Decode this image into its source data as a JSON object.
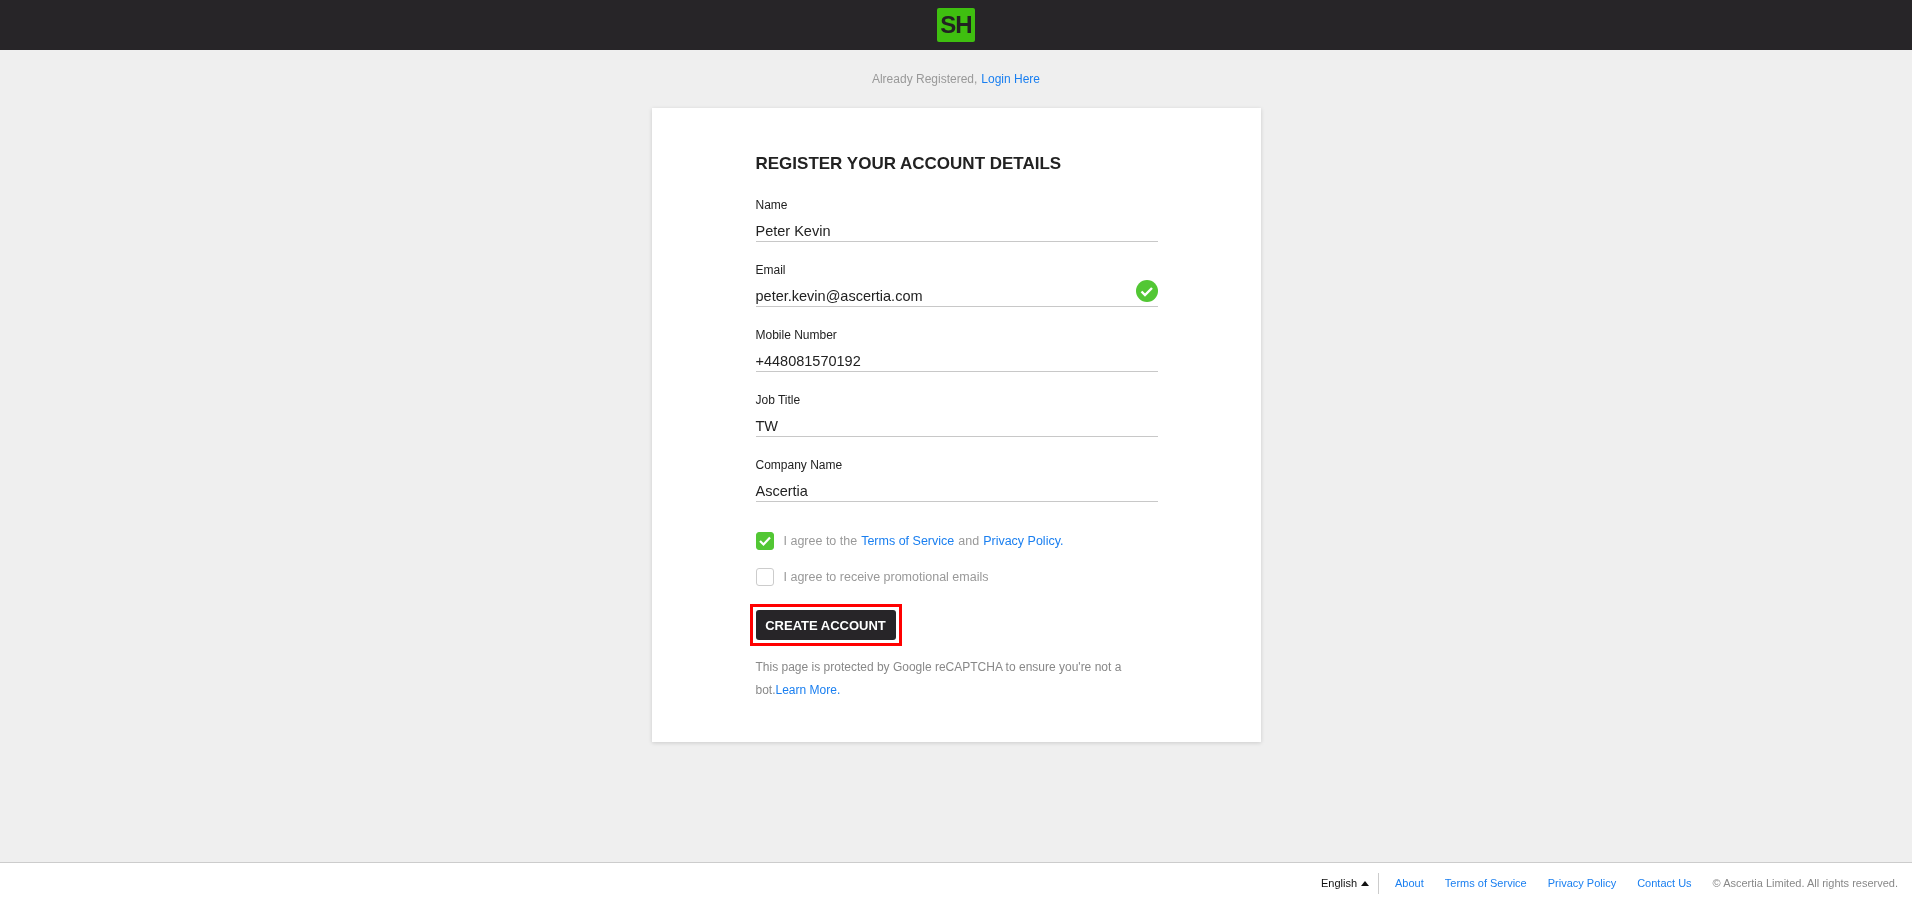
{
  "header": {
    "logo": "SH"
  },
  "login_prompt": {
    "text": "Already Registered,",
    "link": "Login Here"
  },
  "form": {
    "title": "REGISTER YOUR ACCOUNT DETAILS",
    "fields": [
      {
        "label": "Name",
        "value": "Peter Kevin",
        "valid": false
      },
      {
        "label": "Email",
        "value": "peter.kevin@ascertia.com",
        "valid": true
      },
      {
        "label": "Mobile Number",
        "value": "+448081570192",
        "valid": false
      },
      {
        "label": "Job Title",
        "value": "TW",
        "valid": false
      },
      {
        "label": "Company Name",
        "value": "Ascertia",
        "valid": false
      }
    ],
    "checkboxes": [
      {
        "checked": true,
        "parts": [
          {
            "kind": "text",
            "text": "I agree to the"
          },
          {
            "kind": "link",
            "text": "Terms of Service"
          },
          {
            "kind": "text",
            "text": "and"
          },
          {
            "kind": "link",
            "text": "Privacy Policy."
          }
        ]
      },
      {
        "checked": false,
        "parts": [
          {
            "kind": "text",
            "text": "I agree to receive promotional emails"
          }
        ]
      }
    ],
    "submit": {
      "label": "CREATE ACCOUNT",
      "highlighted": true
    },
    "notice": {
      "text": "This page is protected by Google reCAPTCHA to ensure you're not a bot.",
      "link": "Learn More."
    }
  },
  "footer": {
    "language": "English",
    "links": [
      "About",
      "Terms of Service",
      "Privacy Policy",
      "Contact Us"
    ],
    "copyright": "© Ascertia Limited. All rights reserved."
  }
}
